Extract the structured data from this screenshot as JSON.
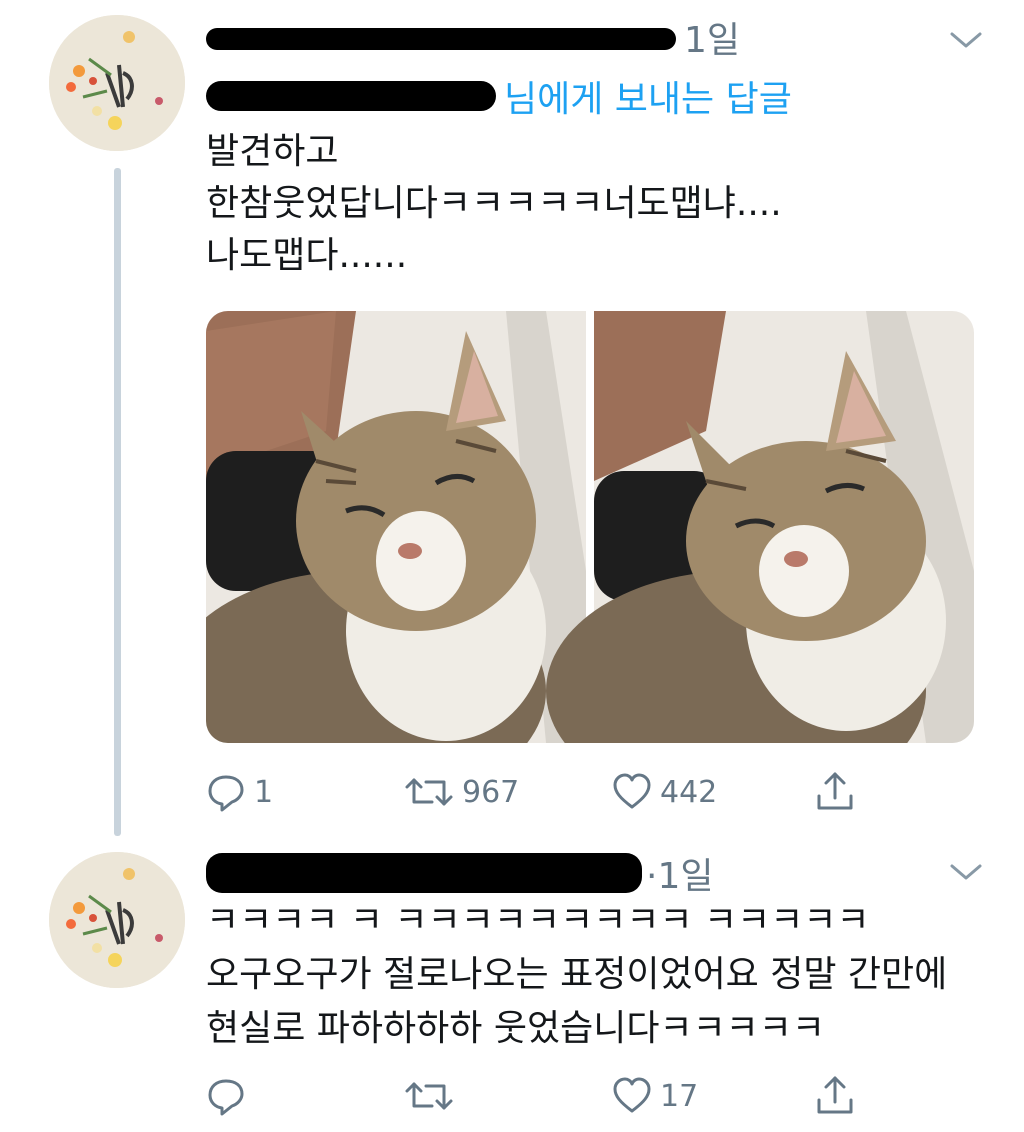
{
  "tweets": [
    {
      "time": "1일",
      "reply_to_suffix": "님에게 보내는 답글",
      "text": "발견하고\n한참웃었답니다ㅋㅋㅋㅋㅋ너도맵냐....\n나도맵다......",
      "actions": {
        "reply_count": "1",
        "retweet_count": "967",
        "like_count": "442"
      },
      "media": [
        "cat-photo-1",
        "cat-photo-2"
      ]
    },
    {
      "time": "·1일",
      "text": "ㅋㅋㅋㅋ ㅋ ㅋㅋㅋㅋㅋㅋㅋㅋㅋ ㅋㅋㅋㅋㅋ\n오구오구가 절로나오는 표정이었어요 정말 간만에\n현실로 파하하하하 웃었습니다ㅋㅋㅋㅋㅋ",
      "actions": {
        "reply_count": "",
        "retweet_count": "",
        "like_count": "17"
      }
    }
  ],
  "icons": {
    "reply": "reply-icon",
    "retweet": "retweet-icon",
    "like": "heart-icon",
    "share": "share-icon",
    "more": "chevron-down-icon"
  },
  "colors": {
    "accent": "#1da1f2",
    "muted": "#657786",
    "thread_line": "#c8d3dc"
  }
}
